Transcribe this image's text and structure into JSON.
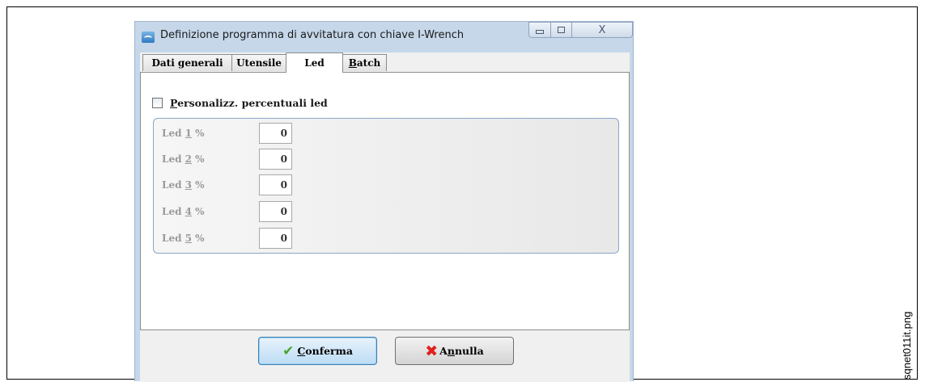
{
  "window": {
    "title": "Definizione programma di avvitatura con chiave I-Wrench",
    "minimize_glyph": "▭",
    "maximize_glyph": "▢",
    "close_glyph": "X"
  },
  "tabs": [
    {
      "label": "Dati generali",
      "active": false
    },
    {
      "label": "Utensile",
      "active": false
    },
    {
      "label": "Led",
      "active": true
    },
    {
      "label_prefix": "",
      "label_underlined": "B",
      "label_suffix": "atch",
      "active": false
    }
  ],
  "personalize": {
    "label_underlined": "P",
    "label_rest": "ersonalizz.  percentuali led",
    "checked": false
  },
  "leds": [
    {
      "prefix": "Led ",
      "key": "1",
      "suffix": " %",
      "value": "0"
    },
    {
      "prefix": "Led ",
      "key": "2",
      "suffix": " %",
      "value": "0"
    },
    {
      "prefix": "Led ",
      "key": "3",
      "suffix": " %",
      "value": "0"
    },
    {
      "prefix": "Led ",
      "key": "4",
      "suffix": " %",
      "value": "0"
    },
    {
      "prefix": "Led ",
      "key": "5",
      "suffix": " %",
      "value": "0"
    }
  ],
  "buttons": {
    "confirm": {
      "icon_glyph": "✔",
      "label_underlined": "C",
      "label_rest": "onferma"
    },
    "cancel": {
      "icon_glyph": "✖",
      "label_prefix": "A",
      "label_underlined": "n",
      "label_rest": "nulla"
    }
  },
  "caption": "sqnet011it.png"
}
